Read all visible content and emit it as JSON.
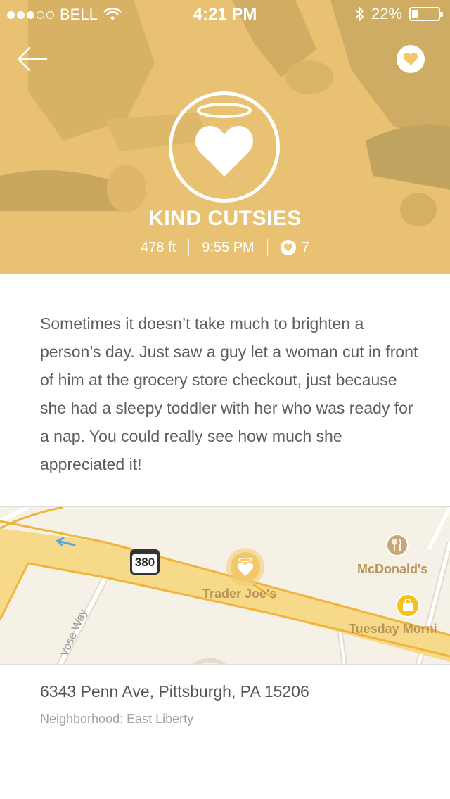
{
  "status_bar": {
    "carrier": "BELL",
    "time": "4:21 PM",
    "battery": "22%",
    "battery_level": 0.22
  },
  "header": {
    "back_icon": "arrow-left-icon",
    "favorite_icon": "heart-icon"
  },
  "post": {
    "category_icon": "halo-heart-icon",
    "title": "KIND CUTSIES",
    "distance": "478 ft",
    "time": "9:55 PM",
    "likes": "7",
    "body": "Sometimes it doesn’t take much to brighten a person’s day. Just saw a guy let a woman cut in front of him at the grocery store checkout, just because she had a sleepy toddler with her who was ready for a nap. You could really see how much she appreciated it!"
  },
  "map": {
    "route_number": "380",
    "street": "Vose Way",
    "places": [
      "Trader Joe's",
      "McDonald's",
      "Tuesday Morni"
    ]
  },
  "location": {
    "address": "6343 Penn Ave, Pittsburgh, PA 15206",
    "neighborhood": "Neighborhood: East Liberty"
  },
  "colors": {
    "accent": "#f2c869",
    "road": "#f7d98a",
    "road_edge": "#f0b43c"
  }
}
